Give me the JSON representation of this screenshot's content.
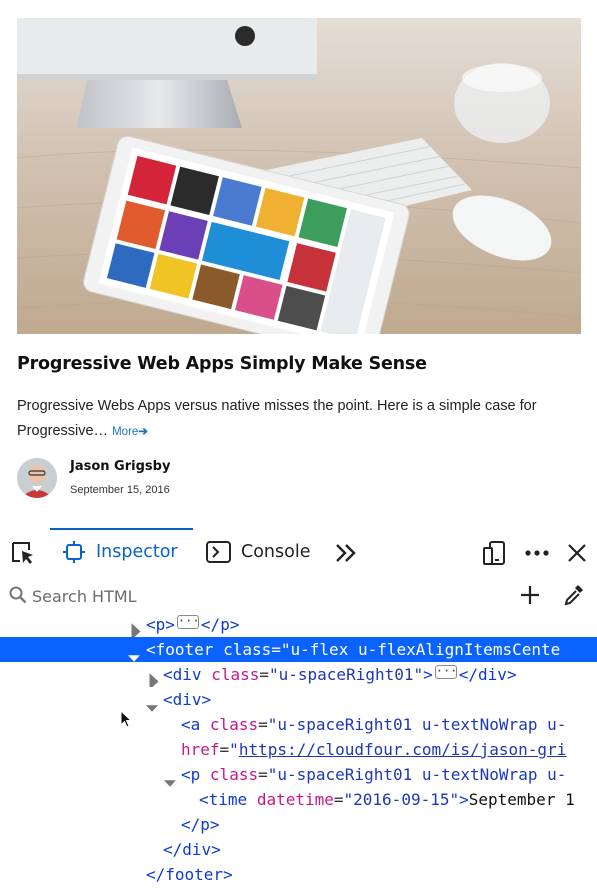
{
  "card": {
    "title": "Progressive Web Apps Simply Make Sense",
    "excerpt": "Progressive Webs Apps versus native misses the point. Here is a simple case for Progressive…",
    "more_label": "More",
    "more_arrow": "➔",
    "author": "Jason Grigsby",
    "date": "September 15, 2016"
  },
  "devtools": {
    "tabs": [
      {
        "label": "Inspector",
        "icon": "inspector-icon",
        "active": true
      },
      {
        "label": "Console",
        "icon": "console-icon",
        "active": false
      }
    ],
    "search_placeholder": "Search HTML",
    "accent_color": "#0a62c9",
    "selection_color": "#0a62ff",
    "tree": {
      "n1": {
        "open": "<",
        "tag": "p",
        "close": ">",
        "end": "</",
        "endtag": "p",
        "endclose": ">"
      },
      "n2": {
        "open": "<",
        "tag": "footer",
        "attr": "class",
        "eq": "=",
        "val": "\"u-flex u-flexAlignItemsCente"
      },
      "n3": {
        "open": "<",
        "tag": "div",
        "attr": "class",
        "eq": "=",
        "val": "\"u-spaceRight01\"",
        "close": ">",
        "end": "</",
        "endtag": "div",
        "endclose": ">"
      },
      "n4": {
        "open": "<",
        "tag": "div",
        "close": ">"
      },
      "n5": {
        "open": "<",
        "tag": "a",
        "attr": "class",
        "eq": "=",
        "val": "\"u-spaceRight01 u-textNoWrap u-"
      },
      "n6": {
        "attr": "href",
        "eq": "=",
        "q": "\"",
        "link": "https://cloudfour.com/is/jason-gri"
      },
      "n7": {
        "open": "<",
        "tag": "p",
        "attr": "class",
        "eq": "=",
        "val": "\"u-spaceRight01 u-textNoWrap u-"
      },
      "n8": {
        "open": "<",
        "tag": "time",
        "attr": "datetime",
        "eq": "=",
        "val": "\"2016-09-15\"",
        "close": ">",
        "text": "September 1"
      },
      "n9": {
        "end": "</",
        "endtag": "p",
        "endclose": ">"
      },
      "n10": {
        "end": "</",
        "endtag": "div",
        "endclose": ">"
      },
      "n11": {
        "end": "</",
        "endtag": "footer",
        "endclose": ">"
      }
    }
  }
}
